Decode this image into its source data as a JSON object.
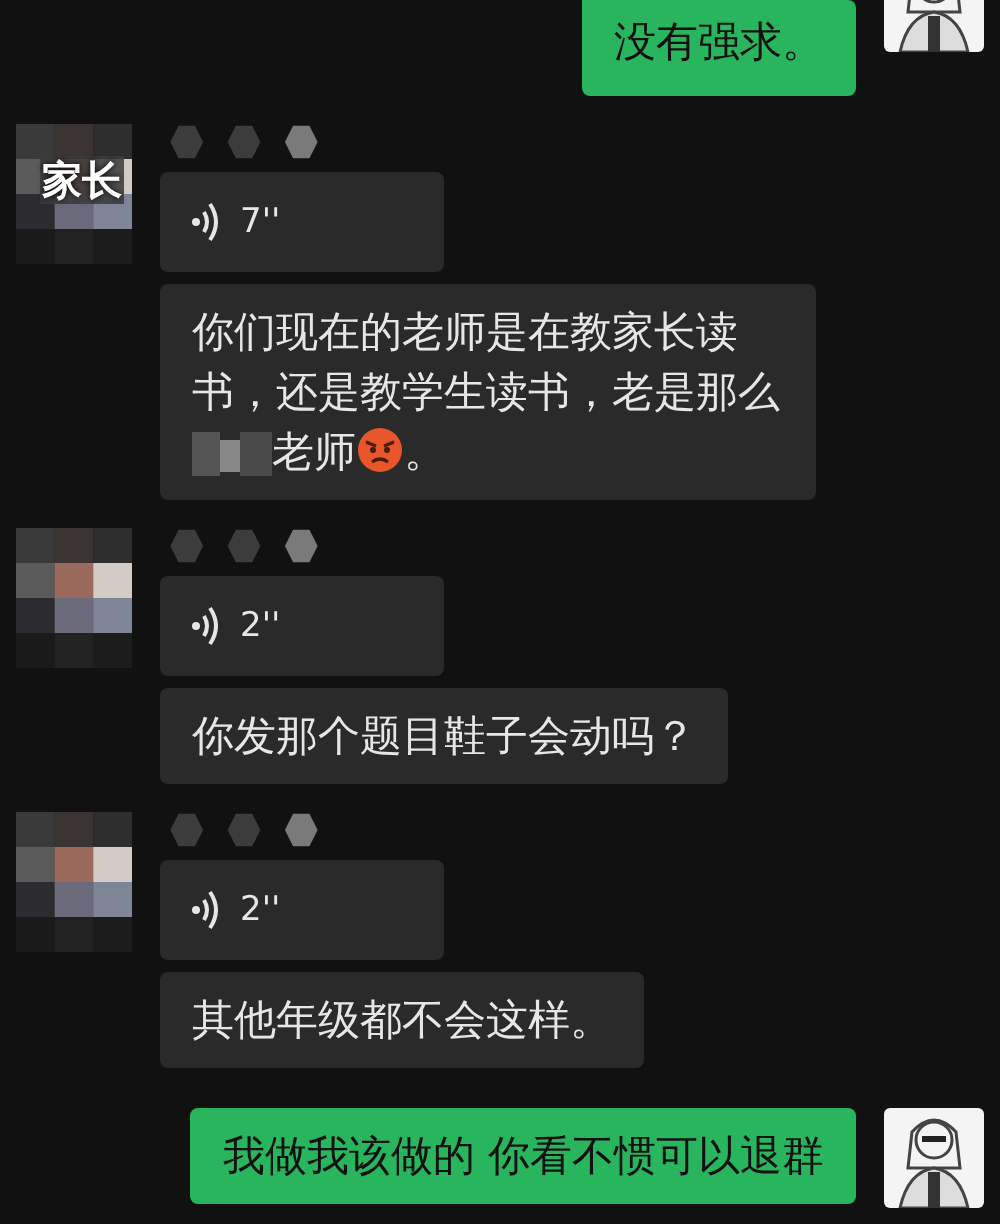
{
  "messages": [
    {
      "kind": "outgoing",
      "cut_top": true,
      "bubbles": [
        {
          "kind": "text",
          "parts": [
            {
              "kind": "text",
              "text": "没有强求。"
            }
          ]
        }
      ]
    },
    {
      "kind": "incoming",
      "avatar_label": "家长",
      "bubbles": [
        {
          "kind": "voice",
          "duration": "7''"
        },
        {
          "kind": "text",
          "parts": [
            {
              "kind": "text",
              "text": "你们现在的老师是在教家长读书，还是教学生读书，老是那么"
            },
            {
              "kind": "redacted"
            },
            {
              "kind": "text",
              "text": "老师"
            },
            {
              "kind": "emoji"
            },
            {
              "kind": "text",
              "text": "。"
            }
          ]
        }
      ]
    },
    {
      "kind": "incoming",
      "bubbles": [
        {
          "kind": "voice",
          "duration": "2''"
        },
        {
          "kind": "text",
          "parts": [
            {
              "kind": "text",
              "text": "你发那个题目鞋子会动吗？"
            }
          ]
        }
      ]
    },
    {
      "kind": "incoming",
      "bubbles": [
        {
          "kind": "voice",
          "duration": "2''"
        },
        {
          "kind": "text",
          "parts": [
            {
              "kind": "text",
              "text": "其他年级都不会这样。"
            }
          ]
        }
      ]
    },
    {
      "kind": "outgoing",
      "bubbles": [
        {
          "kind": "text",
          "parts": [
            {
              "kind": "text",
              "text": "我做我该做的 你看不惯可以退群"
            }
          ]
        }
      ]
    }
  ]
}
